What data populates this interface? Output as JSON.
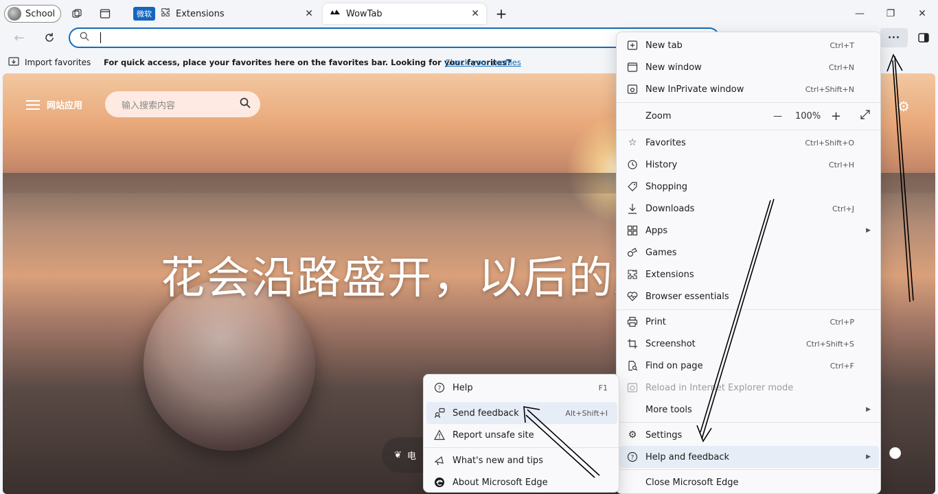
{
  "titlebar": {
    "profile_label": "School",
    "tabs": [
      {
        "badge": "微软",
        "label": "Extensions"
      },
      {
        "label": "WowTab"
      }
    ],
    "close_symbol": "✕",
    "new_tab_symbol": "+"
  },
  "window_controls": {
    "minimize": "—",
    "restore": "❐",
    "close": "✕"
  },
  "addressbar": {
    "value": ""
  },
  "favorites_bar": {
    "import_label": "Import favorites",
    "message": "For quick access, place your favorites here on the favorites bar. Looking for your favorites?",
    "link": "Check your profiles"
  },
  "newtab_page": {
    "apps_label": "网站应用",
    "search_placeholder": "输入搜索内容",
    "hero_text": "花会沿路盛开，以后的路",
    "chip_label": "电"
  },
  "main_menu": {
    "items": {
      "new_tab": {
        "label": "New tab",
        "shortcut": "Ctrl+T"
      },
      "new_window": {
        "label": "New window",
        "shortcut": "Ctrl+N"
      },
      "new_inprivate": {
        "label": "New InPrivate window",
        "shortcut": "Ctrl+Shift+N"
      },
      "zoom": {
        "label": "Zoom",
        "value": "100%",
        "minus": "—",
        "plus": "+"
      },
      "favorites": {
        "label": "Favorites",
        "shortcut": "Ctrl+Shift+O"
      },
      "history": {
        "label": "History",
        "shortcut": "Ctrl+H"
      },
      "shopping": {
        "label": "Shopping"
      },
      "downloads": {
        "label": "Downloads",
        "shortcut": "Ctrl+J"
      },
      "apps": {
        "label": "Apps"
      },
      "games": {
        "label": "Games"
      },
      "extensions": {
        "label": "Extensions"
      },
      "browser_essentials": {
        "label": "Browser essentials"
      },
      "print": {
        "label": "Print",
        "shortcut": "Ctrl+P"
      },
      "screenshot": {
        "label": "Screenshot",
        "shortcut": "Ctrl+Shift+S"
      },
      "find": {
        "label": "Find on page",
        "shortcut": "Ctrl+F"
      },
      "ie_mode": {
        "label": "Reload in Internet Explorer mode"
      },
      "more_tools": {
        "label": "More tools"
      },
      "settings": {
        "label": "Settings"
      },
      "help_feedback": {
        "label": "Help and feedback"
      },
      "close_edge": {
        "label": "Close Microsoft Edge"
      }
    }
  },
  "help_submenu": {
    "help": {
      "label": "Help",
      "shortcut": "F1"
    },
    "send_feedback": {
      "label": "Send feedback",
      "shortcut": "Alt+Shift+I"
    },
    "report_unsafe": {
      "label": "Report unsafe site"
    },
    "whats_new": {
      "label": "What's new and tips"
    },
    "about": {
      "label": "About Microsoft Edge"
    }
  },
  "more_button_label": "···",
  "colors": {
    "accent": "#0f6cbd",
    "highlight": "#e6edf6",
    "menu_bg": "#f9f9fb"
  }
}
